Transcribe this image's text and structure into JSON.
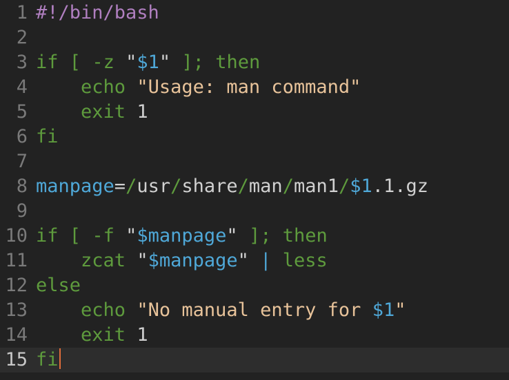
{
  "editor": {
    "language": "bash",
    "current_line": 15,
    "colors": {
      "background": "#222222",
      "current_line_background": "#2d2d2d",
      "line_number": "#7a7a7a",
      "line_number_current": "#c8c8c8",
      "shebang": "#b07fc0",
      "keyword": "#5e9b3d",
      "variable": "#4fa8d8",
      "string": "#e8c39a",
      "plain": "#d0d0d0",
      "cursor": "#e06c3a"
    },
    "lines": [
      {
        "n": "1",
        "tokens": [
          {
            "t": "#!/bin/bash",
            "c": "shebang"
          }
        ]
      },
      {
        "n": "2",
        "tokens": []
      },
      {
        "n": "3",
        "tokens": [
          {
            "t": "if",
            "c": "keyword"
          },
          {
            "t": " ",
            "c": "plain"
          },
          {
            "t": "[",
            "c": "keyword"
          },
          {
            "t": " ",
            "c": "plain"
          },
          {
            "t": "-z",
            "c": "keyword"
          },
          {
            "t": " ",
            "c": "plain"
          },
          {
            "t": "\"",
            "c": "plain"
          },
          {
            "t": "$1",
            "c": "variable"
          },
          {
            "t": "\"",
            "c": "plain"
          },
          {
            "t": " ",
            "c": "plain"
          },
          {
            "t": "];",
            "c": "keyword"
          },
          {
            "t": " ",
            "c": "plain"
          },
          {
            "t": "then",
            "c": "keyword"
          }
        ]
      },
      {
        "n": "4",
        "tokens": [
          {
            "t": "    ",
            "c": "plain"
          },
          {
            "t": "echo",
            "c": "keyword"
          },
          {
            "t": " ",
            "c": "plain"
          },
          {
            "t": "\"Usage: man command\"",
            "c": "string"
          }
        ]
      },
      {
        "n": "5",
        "tokens": [
          {
            "t": "    ",
            "c": "plain"
          },
          {
            "t": "exit",
            "c": "keyword"
          },
          {
            "t": " 1",
            "c": "plain"
          }
        ]
      },
      {
        "n": "6",
        "tokens": [
          {
            "t": "fi",
            "c": "keyword"
          }
        ]
      },
      {
        "n": "7",
        "tokens": []
      },
      {
        "n": "8",
        "tokens": [
          {
            "t": "manpage",
            "c": "variable"
          },
          {
            "t": "=",
            "c": "plain"
          },
          {
            "t": "/",
            "c": "keyword"
          },
          {
            "t": "usr",
            "c": "plain"
          },
          {
            "t": "/",
            "c": "keyword"
          },
          {
            "t": "share",
            "c": "plain"
          },
          {
            "t": "/",
            "c": "keyword"
          },
          {
            "t": "man",
            "c": "plain"
          },
          {
            "t": "/",
            "c": "keyword"
          },
          {
            "t": "man1",
            "c": "plain"
          },
          {
            "t": "/",
            "c": "keyword"
          },
          {
            "t": "$1",
            "c": "variable"
          },
          {
            "t": ".1.gz",
            "c": "plain"
          }
        ]
      },
      {
        "n": "9",
        "tokens": []
      },
      {
        "n": "10",
        "tokens": [
          {
            "t": "if",
            "c": "keyword"
          },
          {
            "t": " ",
            "c": "plain"
          },
          {
            "t": "[",
            "c": "keyword"
          },
          {
            "t": " ",
            "c": "plain"
          },
          {
            "t": "-f",
            "c": "keyword"
          },
          {
            "t": " ",
            "c": "plain"
          },
          {
            "t": "\"",
            "c": "plain"
          },
          {
            "t": "$manpage",
            "c": "variable"
          },
          {
            "t": "\"",
            "c": "plain"
          },
          {
            "t": " ",
            "c": "plain"
          },
          {
            "t": "];",
            "c": "keyword"
          },
          {
            "t": " ",
            "c": "plain"
          },
          {
            "t": "then",
            "c": "keyword"
          }
        ]
      },
      {
        "n": "11",
        "tokens": [
          {
            "t": "    ",
            "c": "plain"
          },
          {
            "t": "zcat",
            "c": "keyword"
          },
          {
            "t": " ",
            "c": "plain"
          },
          {
            "t": "\"",
            "c": "plain"
          },
          {
            "t": "$manpage",
            "c": "variable"
          },
          {
            "t": "\"",
            "c": "plain"
          },
          {
            "t": " ",
            "c": "plain"
          },
          {
            "t": "|",
            "c": "variable"
          },
          {
            "t": " ",
            "c": "plain"
          },
          {
            "t": "less",
            "c": "keyword"
          }
        ]
      },
      {
        "n": "12",
        "tokens": [
          {
            "t": "else",
            "c": "keyword"
          }
        ]
      },
      {
        "n": "13",
        "tokens": [
          {
            "t": "    ",
            "c": "plain"
          },
          {
            "t": "echo",
            "c": "keyword"
          },
          {
            "t": " ",
            "c": "plain"
          },
          {
            "t": "\"No manual entry for ",
            "c": "string"
          },
          {
            "t": "$1",
            "c": "variable"
          },
          {
            "t": "\"",
            "c": "string"
          }
        ]
      },
      {
        "n": "14",
        "tokens": [
          {
            "t": "    ",
            "c": "plain"
          },
          {
            "t": "exit",
            "c": "keyword"
          },
          {
            "t": " 1",
            "c": "plain"
          }
        ]
      },
      {
        "n": "15",
        "tokens": [
          {
            "t": "fi",
            "c": "keyword"
          }
        ]
      }
    ]
  }
}
